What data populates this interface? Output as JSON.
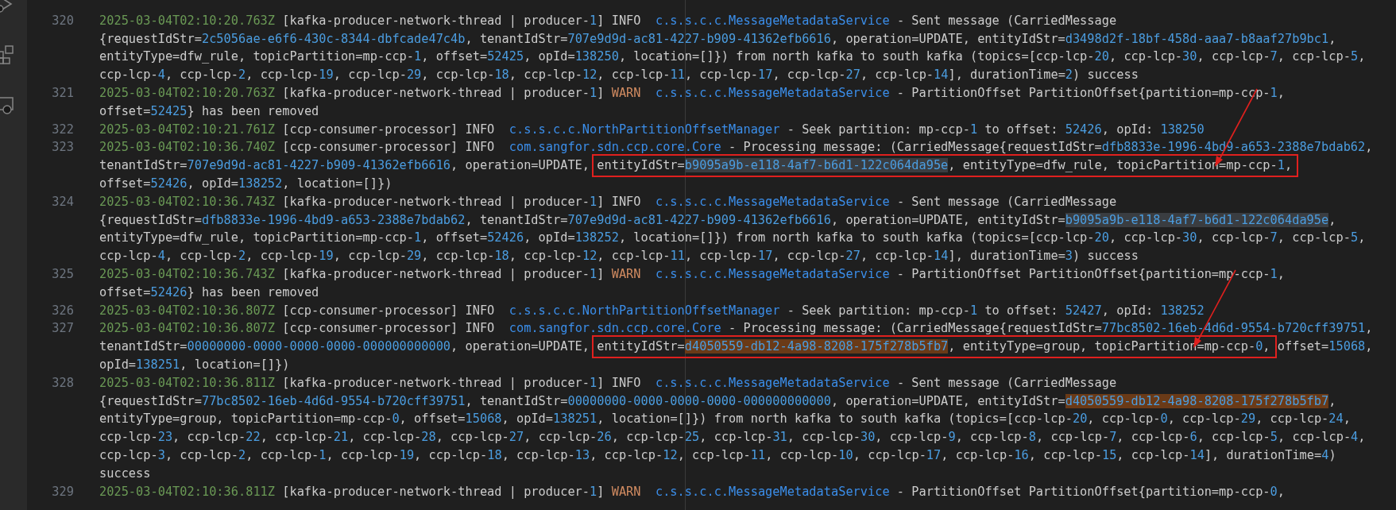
{
  "activity_bar": {
    "icons": [
      {
        "kind": "run"
      },
      {
        "kind": "extensions"
      },
      {
        "kind": "remote"
      }
    ]
  },
  "entries": [
    {
      "number": "320",
      "lines": [
        [
          {
            "kind": "time",
            "text": "2025-03-04T02:10:20.763Z"
          },
          {
            "kind": "plain",
            "text": " [kafka-producer-network-thread | producer-"
          },
          {
            "kind": "num",
            "text": "1"
          },
          {
            "kind": "plain",
            "text": "] INFO  "
          },
          {
            "kind": "class",
            "text": "c.s.s.c.c.MessageMetadataService"
          },
          {
            "kind": "plain",
            "text": " - Sent message (CarriedMessage"
          }
        ],
        [
          {
            "kind": "plain",
            "text": "{requestIdStr="
          },
          {
            "kind": "num",
            "text": "2c5056ae-e6f6-430c-8344-dbfcade47c4b"
          },
          {
            "kind": "plain",
            "text": ", tenantIdStr="
          },
          {
            "kind": "num",
            "text": "707e9d9d-ac81-4227-b909-41362efb6616"
          },
          {
            "kind": "plain",
            "text": ", operation=UPDATE, entityIdStr="
          },
          {
            "kind": "num",
            "text": "d3498d2f-18bf-458d-aaa7-b8aaf27b9bc1"
          },
          {
            "kind": "plain",
            "text": ","
          }
        ],
        [
          {
            "kind": "plain",
            "text": "entityType=dfw_rule, topicPartition=mp-ccp-"
          },
          {
            "kind": "num",
            "text": "1"
          },
          {
            "kind": "plain",
            "text": ", offset="
          },
          {
            "kind": "num",
            "text": "52425"
          },
          {
            "kind": "plain",
            "text": ", opId="
          },
          {
            "kind": "num",
            "text": "138250"
          },
          {
            "kind": "plain",
            "text": ", location=[]}) from north kafka to south kafka (topics=[ccp-lcp-"
          },
          {
            "kind": "num",
            "text": "20"
          },
          {
            "kind": "plain",
            "text": ", ccp-lcp-"
          },
          {
            "kind": "num",
            "text": "30"
          },
          {
            "kind": "plain",
            "text": ", ccp-lcp-"
          },
          {
            "kind": "num",
            "text": "7"
          },
          {
            "kind": "plain",
            "text": ", ccp-lcp-"
          },
          {
            "kind": "num",
            "text": "5"
          },
          {
            "kind": "plain",
            "text": ","
          }
        ],
        [
          {
            "kind": "plain",
            "text": "ccp-lcp-"
          },
          {
            "kind": "num",
            "text": "4"
          },
          {
            "kind": "plain",
            "text": ", ccp-lcp-"
          },
          {
            "kind": "num",
            "text": "2"
          },
          {
            "kind": "plain",
            "text": ", ccp-lcp-"
          },
          {
            "kind": "num",
            "text": "19"
          },
          {
            "kind": "plain",
            "text": ", ccp-lcp-"
          },
          {
            "kind": "num",
            "text": "29"
          },
          {
            "kind": "plain",
            "text": ", ccp-lcp-"
          },
          {
            "kind": "num",
            "text": "18"
          },
          {
            "kind": "plain",
            "text": ", ccp-lcp-"
          },
          {
            "kind": "num",
            "text": "12"
          },
          {
            "kind": "plain",
            "text": ", ccp-lcp-"
          },
          {
            "kind": "num",
            "text": "11"
          },
          {
            "kind": "plain",
            "text": ", ccp-lcp-"
          },
          {
            "kind": "num",
            "text": "17"
          },
          {
            "kind": "plain",
            "text": ", ccp-lcp-"
          },
          {
            "kind": "num",
            "text": "27"
          },
          {
            "kind": "plain",
            "text": ", ccp-lcp-"
          },
          {
            "kind": "num",
            "text": "14"
          },
          {
            "kind": "plain",
            "text": "], durationTime="
          },
          {
            "kind": "num",
            "text": "2"
          },
          {
            "kind": "plain",
            "text": ") success"
          }
        ]
      ]
    },
    {
      "number": "321",
      "lines": [
        [
          {
            "kind": "time",
            "text": "2025-03-04T02:10:20.763Z"
          },
          {
            "kind": "plain",
            "text": " [kafka-producer-network-thread | producer-"
          },
          {
            "kind": "num",
            "text": "1"
          },
          {
            "kind": "plain",
            "text": "] "
          },
          {
            "kind": "warn",
            "text": "WARN"
          },
          {
            "kind": "class",
            "text": "  c.s.s.c.c.MessageMetadataService"
          },
          {
            "kind": "plain",
            "text": " - PartitionOffset PartitionOffset{partition=mp-ccp-"
          },
          {
            "kind": "num",
            "text": "1"
          },
          {
            "kind": "plain",
            "text": ","
          }
        ],
        [
          {
            "kind": "plain",
            "text": "offset="
          },
          {
            "kind": "num",
            "text": "52425"
          },
          {
            "kind": "plain",
            "text": "} has been removed"
          }
        ]
      ]
    },
    {
      "number": "322",
      "lines": [
        [
          {
            "kind": "time",
            "text": "2025-03-04T02:10:21.761Z"
          },
          {
            "kind": "plain",
            "text": " [ccp-consumer-processor] INFO  "
          },
          {
            "kind": "class",
            "text": "c.s.s.c.c.NorthPartitionOffsetManager"
          },
          {
            "kind": "plain",
            "text": " - Seek partition: mp-ccp-"
          },
          {
            "kind": "num",
            "text": "1"
          },
          {
            "kind": "plain",
            "text": " to offset: "
          },
          {
            "kind": "num",
            "text": "52426"
          },
          {
            "kind": "plain",
            "text": ", opId: "
          },
          {
            "kind": "num",
            "text": "138250"
          }
        ]
      ]
    },
    {
      "number": "323",
      "lines": [
        [
          {
            "kind": "time",
            "text": "2025-03-04T02:10:36.740Z"
          },
          {
            "kind": "plain",
            "text": " [ccp-consumer-processor] INFO  "
          },
          {
            "kind": "class",
            "text": "com.sangfor.sdn.ccp.core.Core"
          },
          {
            "kind": "plain",
            "text": " - Processing message: (CarriedMessage{requestIdStr="
          },
          {
            "kind": "num",
            "text": "dfb8833e-1996-4bd9-a653-2388e7bdab62"
          },
          {
            "kind": "plain",
            "text": ","
          }
        ],
        [
          {
            "kind": "plain",
            "text": "tenantIdStr="
          },
          {
            "kind": "num",
            "text": "707e9d9d-ac81-4227-b909-41362efb6616"
          },
          {
            "kind": "plain",
            "text": ", operation=UPDATE, "
          },
          {
            "kind": "box",
            "arrow": true,
            "segments": [
              {
                "kind": "plain",
                "text": "entityIdStr="
              },
              {
                "kind": "selection",
                "text": "b9095a9b-e118-4af7-b6d1-122c064da95e"
              },
              {
                "kind": "plain",
                "text": ", entityType=dfw_rule, topicPartition=mp-ccp-"
              },
              {
                "kind": "num",
                "text": "1"
              },
              {
                "kind": "plain",
                "text": ","
              }
            ]
          }
        ],
        [
          {
            "kind": "plain",
            "text": "offset="
          },
          {
            "kind": "num",
            "text": "52426"
          },
          {
            "kind": "plain",
            "text": ", opId="
          },
          {
            "kind": "num",
            "text": "138252"
          },
          {
            "kind": "plain",
            "text": ", location=[]})"
          }
        ]
      ]
    },
    {
      "number": "324",
      "lines": [
        [
          {
            "kind": "time",
            "text": "2025-03-04T02:10:36.743Z"
          },
          {
            "kind": "plain",
            "text": " [kafka-producer-network-thread | producer-"
          },
          {
            "kind": "num",
            "text": "1"
          },
          {
            "kind": "plain",
            "text": "] INFO  "
          },
          {
            "kind": "class",
            "text": "c.s.s.c.c.MessageMetadataService"
          },
          {
            "kind": "plain",
            "text": " - Sent message (CarriedMessage"
          }
        ],
        [
          {
            "kind": "plain",
            "text": "{requestIdStr="
          },
          {
            "kind": "num",
            "text": "dfb8833e-1996-4bd9-a653-2388e7bdab62"
          },
          {
            "kind": "plain",
            "text": ", tenantIdStr="
          },
          {
            "kind": "num",
            "text": "707e9d9d-ac81-4227-b909-41362efb6616"
          },
          {
            "kind": "plain",
            "text": ", operation=UPDATE, entityIdStr="
          },
          {
            "kind": "selection",
            "text": "b9095a9b-e118-4af7-b6d1-122c064da95e"
          },
          {
            "kind": "plain",
            "text": ","
          }
        ],
        [
          {
            "kind": "plain",
            "text": "entityType=dfw_rule, topicPartition=mp-ccp-"
          },
          {
            "kind": "num",
            "text": "1"
          },
          {
            "kind": "plain",
            "text": ", offset="
          },
          {
            "kind": "num",
            "text": "52426"
          },
          {
            "kind": "plain",
            "text": ", opId="
          },
          {
            "kind": "num",
            "text": "138252"
          },
          {
            "kind": "plain",
            "text": ", location=[]}) from north kafka to south kafka (topics=[ccp-lcp-"
          },
          {
            "kind": "num",
            "text": "20"
          },
          {
            "kind": "plain",
            "text": ", ccp-lcp-"
          },
          {
            "kind": "num",
            "text": "30"
          },
          {
            "kind": "plain",
            "text": ", ccp-lcp-"
          },
          {
            "kind": "num",
            "text": "7"
          },
          {
            "kind": "plain",
            "text": ", ccp-lcp-"
          },
          {
            "kind": "num",
            "text": "5"
          },
          {
            "kind": "plain",
            "text": ","
          }
        ],
        [
          {
            "kind": "plain",
            "text": "ccp-lcp-"
          },
          {
            "kind": "num",
            "text": "4"
          },
          {
            "kind": "plain",
            "text": ", ccp-lcp-"
          },
          {
            "kind": "num",
            "text": "2"
          },
          {
            "kind": "plain",
            "text": ", ccp-lcp-"
          },
          {
            "kind": "num",
            "text": "19"
          },
          {
            "kind": "plain",
            "text": ", ccp-lcp-"
          },
          {
            "kind": "num",
            "text": "29"
          },
          {
            "kind": "plain",
            "text": ", ccp-lcp-"
          },
          {
            "kind": "num",
            "text": "18"
          },
          {
            "kind": "plain",
            "text": ", ccp-lcp-"
          },
          {
            "kind": "num",
            "text": "12"
          },
          {
            "kind": "plain",
            "text": ", ccp-lcp-"
          },
          {
            "kind": "num",
            "text": "11"
          },
          {
            "kind": "plain",
            "text": ", ccp-lcp-"
          },
          {
            "kind": "num",
            "text": "17"
          },
          {
            "kind": "plain",
            "text": ", ccp-lcp-"
          },
          {
            "kind": "num",
            "text": "27"
          },
          {
            "kind": "plain",
            "text": ", ccp-lcp-"
          },
          {
            "kind": "num",
            "text": "14"
          },
          {
            "kind": "plain",
            "text": "], durationTime="
          },
          {
            "kind": "num",
            "text": "3"
          },
          {
            "kind": "plain",
            "text": ") success"
          }
        ]
      ]
    },
    {
      "number": "325",
      "lines": [
        [
          {
            "kind": "time",
            "text": "2025-03-04T02:10:36.743Z"
          },
          {
            "kind": "plain",
            "text": " [kafka-producer-network-thread | producer-"
          },
          {
            "kind": "num",
            "text": "1"
          },
          {
            "kind": "plain",
            "text": "] "
          },
          {
            "kind": "warn",
            "text": "WARN"
          },
          {
            "kind": "class",
            "text": "  c.s.s.c.c.MessageMetadataService"
          },
          {
            "kind": "plain",
            "text": " - PartitionOffset PartitionOffset{partition=mp-ccp-"
          },
          {
            "kind": "num",
            "text": "1"
          },
          {
            "kind": "plain",
            "text": ","
          }
        ],
        [
          {
            "kind": "plain",
            "text": "offset="
          },
          {
            "kind": "num",
            "text": "52426"
          },
          {
            "kind": "plain",
            "text": "} has been removed"
          }
        ]
      ]
    },
    {
      "number": "326",
      "lines": [
        [
          {
            "kind": "time",
            "text": "2025-03-04T02:10:36.807Z"
          },
          {
            "kind": "plain",
            "text": " [ccp-consumer-processor] INFO  "
          },
          {
            "kind": "class",
            "text": "c.s.s.c.c.NorthPartitionOffsetManager"
          },
          {
            "kind": "plain",
            "text": " - Seek partition: mp-ccp-"
          },
          {
            "kind": "num",
            "text": "1"
          },
          {
            "kind": "plain",
            "text": " to offset: "
          },
          {
            "kind": "num",
            "text": "52427"
          },
          {
            "kind": "plain",
            "text": ", opId: "
          },
          {
            "kind": "num",
            "text": "138252"
          }
        ]
      ]
    },
    {
      "number": "327",
      "lines": [
        [
          {
            "kind": "time",
            "text": "2025-03-04T02:10:36.807Z"
          },
          {
            "kind": "plain",
            "text": " [ccp-consumer-processor] INFO  "
          },
          {
            "kind": "class",
            "text": "com.sangfor.sdn.ccp.core.Core"
          },
          {
            "kind": "plain",
            "text": " - Processing message: (CarriedMessage{requestIdStr="
          },
          {
            "kind": "num",
            "text": "77bc8502-16eb-4d6d-9554-b720cff39751"
          },
          {
            "kind": "plain",
            "text": ","
          }
        ],
        [
          {
            "kind": "plain",
            "text": "tenantIdStr="
          },
          {
            "kind": "num",
            "text": "00000000-0000-0000-0000-000000000000"
          },
          {
            "kind": "plain",
            "text": ", operation=UPDATE, "
          },
          {
            "kind": "box",
            "arrow": true,
            "segments": [
              {
                "kind": "plain",
                "text": "entityIdStr="
              },
              {
                "kind": "match",
                "text": "d4050559-db12-4a98-8208-175f278b5fb7"
              },
              {
                "kind": "plain",
                "text": ", entityType=group, topicPartition=mp-ccp-"
              },
              {
                "kind": "num",
                "text": "0"
              },
              {
                "kind": "plain",
                "text": ","
              }
            ]
          },
          {
            "kind": "plain",
            "text": " offset="
          },
          {
            "kind": "num",
            "text": "15068"
          },
          {
            "kind": "plain",
            "text": ","
          }
        ],
        [
          {
            "kind": "plain",
            "text": "opId="
          },
          {
            "kind": "num",
            "text": "138251"
          },
          {
            "kind": "plain",
            "text": ", location=[]})"
          }
        ]
      ]
    },
    {
      "number": "328",
      "lines": [
        [
          {
            "kind": "time",
            "text": "2025-03-04T02:10:36.811Z"
          },
          {
            "kind": "plain",
            "text": " [kafka-producer-network-thread | producer-"
          },
          {
            "kind": "num",
            "text": "1"
          },
          {
            "kind": "plain",
            "text": "] INFO  "
          },
          {
            "kind": "class",
            "text": "c.s.s.c.c.MessageMetadataService"
          },
          {
            "kind": "plain",
            "text": " - Sent message (CarriedMessage"
          }
        ],
        [
          {
            "kind": "plain",
            "text": "{requestIdStr="
          },
          {
            "kind": "num",
            "text": "77bc8502-16eb-4d6d-9554-b720cff39751"
          },
          {
            "kind": "plain",
            "text": ", tenantIdStr="
          },
          {
            "kind": "num",
            "text": "00000000-0000-0000-0000-000000000000"
          },
          {
            "kind": "plain",
            "text": ", operation=UPDATE, entityIdStr="
          },
          {
            "kind": "match",
            "text": "d4050559-db12-4a98-8208-175f278b5fb7"
          },
          {
            "kind": "plain",
            "text": ","
          }
        ],
        [
          {
            "kind": "plain",
            "text": "entityType=group, topicPartition=mp-ccp-"
          },
          {
            "kind": "num",
            "text": "0"
          },
          {
            "kind": "plain",
            "text": ", offset="
          },
          {
            "kind": "num",
            "text": "15068"
          },
          {
            "kind": "plain",
            "text": ", opId="
          },
          {
            "kind": "num",
            "text": "138251"
          },
          {
            "kind": "plain",
            "text": ", location=[]}) from north kafka to south kafka (topics=[ccp-lcp-"
          },
          {
            "kind": "num",
            "text": "20"
          },
          {
            "kind": "plain",
            "text": ", ccp-lcp-"
          },
          {
            "kind": "num",
            "text": "0"
          },
          {
            "kind": "plain",
            "text": ", ccp-lcp-"
          },
          {
            "kind": "num",
            "text": "29"
          },
          {
            "kind": "plain",
            "text": ", ccp-lcp-"
          },
          {
            "kind": "num",
            "text": "24"
          },
          {
            "kind": "plain",
            "text": ","
          }
        ],
        [
          {
            "kind": "plain",
            "text": "ccp-lcp-"
          },
          {
            "kind": "num",
            "text": "23"
          },
          {
            "kind": "plain",
            "text": ", ccp-lcp-"
          },
          {
            "kind": "num",
            "text": "22"
          },
          {
            "kind": "plain",
            "text": ", ccp-lcp-"
          },
          {
            "kind": "num",
            "text": "21"
          },
          {
            "kind": "plain",
            "text": ", ccp-lcp-"
          },
          {
            "kind": "num",
            "text": "28"
          },
          {
            "kind": "plain",
            "text": ", ccp-lcp-"
          },
          {
            "kind": "num",
            "text": "27"
          },
          {
            "kind": "plain",
            "text": ", ccp-lcp-"
          },
          {
            "kind": "num",
            "text": "26"
          },
          {
            "kind": "plain",
            "text": ", ccp-lcp-"
          },
          {
            "kind": "num",
            "text": "25"
          },
          {
            "kind": "plain",
            "text": ", ccp-lcp-"
          },
          {
            "kind": "num",
            "text": "31"
          },
          {
            "kind": "plain",
            "text": ", ccp-lcp-"
          },
          {
            "kind": "num",
            "text": "30"
          },
          {
            "kind": "plain",
            "text": ", ccp-lcp-"
          },
          {
            "kind": "num",
            "text": "9"
          },
          {
            "kind": "plain",
            "text": ", ccp-lcp-"
          },
          {
            "kind": "num",
            "text": "8"
          },
          {
            "kind": "plain",
            "text": ", ccp-lcp-"
          },
          {
            "kind": "num",
            "text": "7"
          },
          {
            "kind": "plain",
            "text": ", ccp-lcp-"
          },
          {
            "kind": "num",
            "text": "6"
          },
          {
            "kind": "plain",
            "text": ", ccp-lcp-"
          },
          {
            "kind": "num",
            "text": "5"
          },
          {
            "kind": "plain",
            "text": ", ccp-lcp-"
          },
          {
            "kind": "num",
            "text": "4"
          },
          {
            "kind": "plain",
            "text": ","
          }
        ],
        [
          {
            "kind": "plain",
            "text": "ccp-lcp-"
          },
          {
            "kind": "num",
            "text": "3"
          },
          {
            "kind": "plain",
            "text": ", ccp-lcp-"
          },
          {
            "kind": "num",
            "text": "2"
          },
          {
            "kind": "plain",
            "text": ", ccp-lcp-"
          },
          {
            "kind": "num",
            "text": "1"
          },
          {
            "kind": "plain",
            "text": ", ccp-lcp-"
          },
          {
            "kind": "num",
            "text": "19"
          },
          {
            "kind": "plain",
            "text": ", ccp-lcp-"
          },
          {
            "kind": "num",
            "text": "18"
          },
          {
            "kind": "plain",
            "text": ", ccp-lcp-"
          },
          {
            "kind": "num",
            "text": "13"
          },
          {
            "kind": "plain",
            "text": ", ccp-lcp-"
          },
          {
            "kind": "num",
            "text": "12"
          },
          {
            "kind": "plain",
            "text": ", ccp-lcp-"
          },
          {
            "kind": "num",
            "text": "11"
          },
          {
            "kind": "plain",
            "text": ", ccp-lcp-"
          },
          {
            "kind": "num",
            "text": "10"
          },
          {
            "kind": "plain",
            "text": ", ccp-lcp-"
          },
          {
            "kind": "num",
            "text": "17"
          },
          {
            "kind": "plain",
            "text": ", ccp-lcp-"
          },
          {
            "kind": "num",
            "text": "16"
          },
          {
            "kind": "plain",
            "text": ", ccp-lcp-"
          },
          {
            "kind": "num",
            "text": "15"
          },
          {
            "kind": "plain",
            "text": ", ccp-lcp-"
          },
          {
            "kind": "num",
            "text": "14"
          },
          {
            "kind": "plain",
            "text": "], durationTime="
          },
          {
            "kind": "num",
            "text": "4"
          },
          {
            "kind": "plain",
            "text": ")"
          }
        ],
        [
          {
            "kind": "plain",
            "text": "success"
          }
        ]
      ]
    },
    {
      "number": "329",
      "lines": [
        [
          {
            "kind": "time",
            "text": "2025-03-04T02:10:36.811Z"
          },
          {
            "kind": "plain",
            "text": " [kafka-producer-network-thread | producer-"
          },
          {
            "kind": "num",
            "text": "1"
          },
          {
            "kind": "plain",
            "text": "] "
          },
          {
            "kind": "warn",
            "text": "WARN"
          },
          {
            "kind": "class",
            "text": "  c.s.s.c.c.MessageMetadataService"
          },
          {
            "kind": "plain",
            "text": " - PartitionOffset PartitionOffset{partition=mp-ccp-"
          },
          {
            "kind": "num",
            "text": "0"
          },
          {
            "kind": "plain",
            "text": ","
          }
        ]
      ]
    }
  ]
}
